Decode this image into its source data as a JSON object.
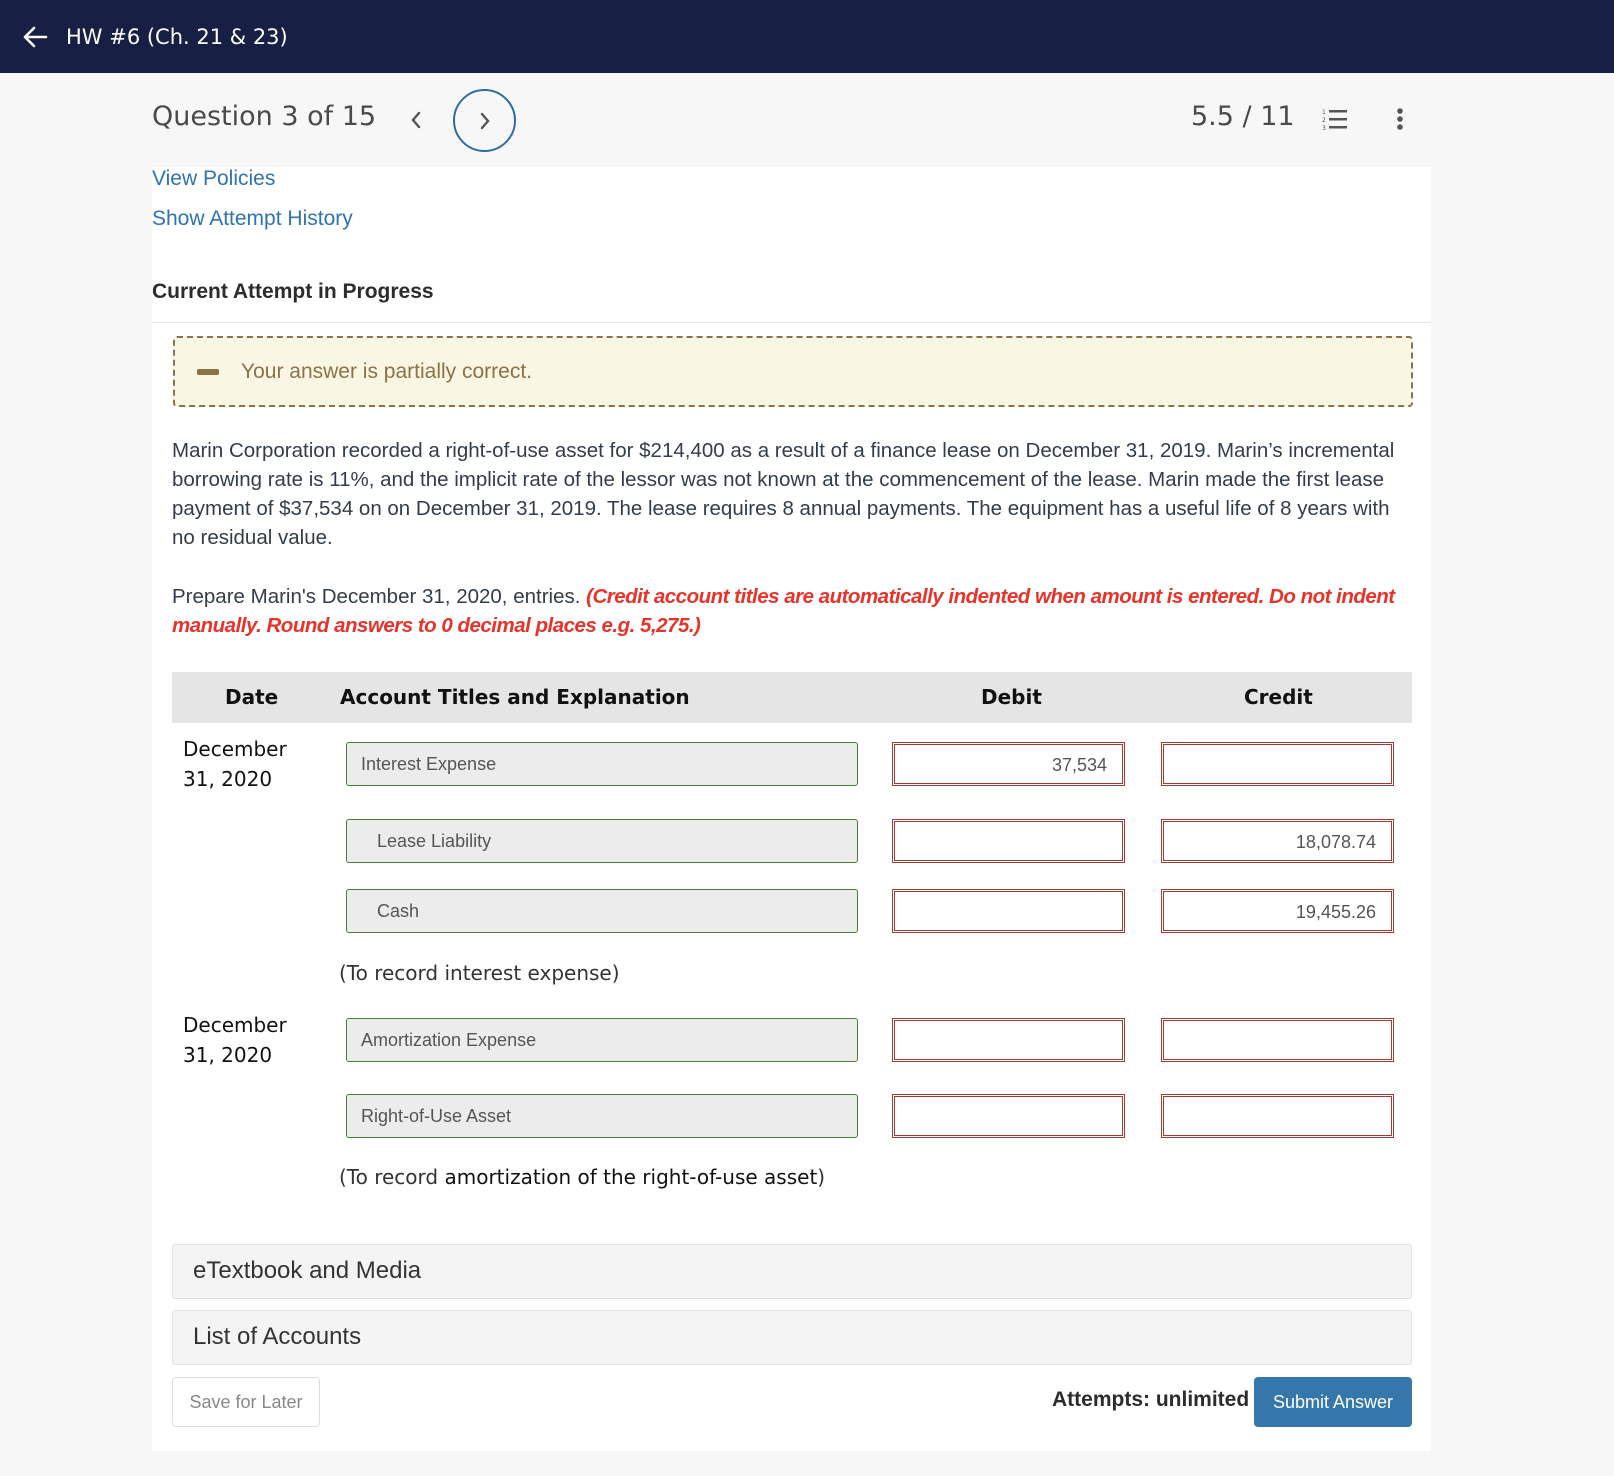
{
  "topbar": {
    "title": "HW #6 (Ch. 21 & 23)",
    "back_icon": "arrow-left-icon"
  },
  "question_nav": {
    "label": "Question 3 of 15",
    "prev_icon": "chevron-left-icon",
    "next_icon": "chevron-right-icon",
    "score": "5.5 / 11",
    "list_icon": "numbered-list-icon",
    "more_icon": "vertical-ellipsis-icon"
  },
  "links": {
    "view_policies": "View Policies",
    "show_attempt_history": "Show Attempt History"
  },
  "attempt_heading": "Current Attempt in Progress",
  "feedback": {
    "icon": "minus-icon",
    "message": "Your answer is partially correct.",
    "color": "#8a7348"
  },
  "problem": {
    "text": "Marin Corporation recorded a right-of-use asset for $214,400 as a result of a finance lease on December 31, 2019. Marin’s incremental borrowing rate is 11%, and the implicit rate of the lessor was not known at the commencement of the lease. Marin made the first lease payment of $37,534 on on December 31, 2019. The lease requires 8 annual payments. The equipment has a useful life of 8 years with no residual value.",
    "instruction": "Prepare Marin's December 31, 2020, entries. ",
    "instruction_note": "(Credit account titles are automatically indented when amount is entered. Do not indent manually. Round answers to 0 decimal places e.g. 5,275.)"
  },
  "table": {
    "headers": {
      "date": "Date",
      "account": "Account Titles and Explanation",
      "debit": "Debit",
      "credit": "Credit"
    },
    "entries": [
      {
        "date": "December 31, 2020",
        "rows": [
          {
            "account": "Interest Expense",
            "debit": "37,534",
            "credit": ""
          },
          {
            "account": "Lease Liability",
            "debit": "",
            "credit": "18,078.74"
          },
          {
            "account": "Cash",
            "debit": "",
            "credit": "19,455.26"
          }
        ],
        "note": "(To record interest expense)"
      },
      {
        "date": "December 31, 2020",
        "rows": [
          {
            "account": "Amortization Expense",
            "debit": "",
            "credit": ""
          },
          {
            "account": "Right-of-Use Asset",
            "debit": "",
            "credit": ""
          }
        ],
        "note_prefix": "(To record ",
        "note_rest": "amortization of the right-of-use asset",
        "note_suffix": ")"
      }
    ]
  },
  "accordions": {
    "etextbook": "eTextbook and Media",
    "accounts": "List of Accounts"
  },
  "footer": {
    "save_label": "Save for Later",
    "attempts": "Attempts: unlimited",
    "submit_label": "Submit Answer"
  },
  "colors": {
    "topbar": "#171f44",
    "link": "#2f73b0",
    "instruction_red": "#e8332a",
    "submit": "#3577ab",
    "incorrect_border": "#9e3c36",
    "correct_border": "#4c7a3c"
  }
}
